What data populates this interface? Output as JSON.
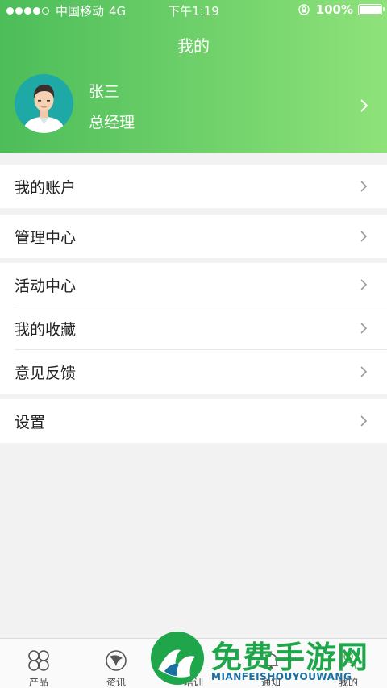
{
  "status_bar": {
    "carrier": "中国移动",
    "network": "4G",
    "time": "下午1:19",
    "battery": "100%",
    "battery_level": 1.0
  },
  "header": {
    "title": "我的"
  },
  "profile": {
    "name": "张三",
    "role": "总经理"
  },
  "menu": {
    "account": "我的账户",
    "management": "管理中心",
    "activity": "活动中心",
    "favorites": "我的收藏",
    "feedback": "意见反馈",
    "settings": "设置"
  },
  "tabbar": {
    "items": [
      {
        "label": "产品",
        "icon": "clover-icon"
      },
      {
        "label": "资讯",
        "icon": "news-icon"
      },
      {
        "label": "培训",
        "icon": "training-icon"
      },
      {
        "label": "通知",
        "icon": "bell-icon"
      },
      {
        "label": "我的",
        "icon": "person-icon"
      }
    ]
  },
  "watermark": {
    "title": "免费手游网",
    "subtitle": "MIANFEISHOUYOUWANG"
  },
  "colors": {
    "header_start": "#4cbd59",
    "header_end": "#8fe27a",
    "avatar_bg": "#1fa9a6"
  }
}
